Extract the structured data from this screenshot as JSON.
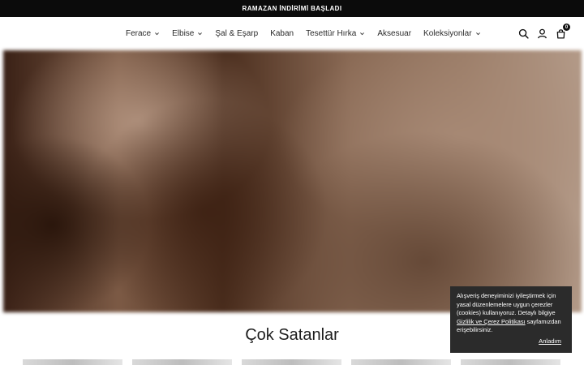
{
  "announcement": "RAMAZAN İNDİRİMİ BAŞLADI",
  "nav": [
    {
      "label": "Ferace",
      "has_dropdown": true
    },
    {
      "label": "Elbise",
      "has_dropdown": true
    },
    {
      "label": "Şal & Eşarp",
      "has_dropdown": false
    },
    {
      "label": "Kaban",
      "has_dropdown": false
    },
    {
      "label": "Tesettür Hırka",
      "has_dropdown": true
    },
    {
      "label": "Aksesuar",
      "has_dropdown": false
    },
    {
      "label": "Koleksiyonlar",
      "has_dropdown": true
    }
  ],
  "header_icons": {
    "search": "search-icon",
    "account": "user-icon",
    "cart": "bag-icon",
    "cart_count": "0"
  },
  "section_title": "Çok Satanlar",
  "cookie": {
    "text_before": "Alışveriş deneyiminizi iyileştirmek için yasal düzenlemelere uygun çerezler (cookies) kullanıyoruz. Detaylı bilgiye ",
    "link": "Gizlilik ve Çerez Politikası",
    "text_after": " sayfamızdan erişebilirsiniz.",
    "accept": "Anladım"
  },
  "colors": {
    "announce_bg": "#0b0b0b",
    "cookie_bg": "#2b2b2b",
    "text": "#2a2a2a"
  }
}
